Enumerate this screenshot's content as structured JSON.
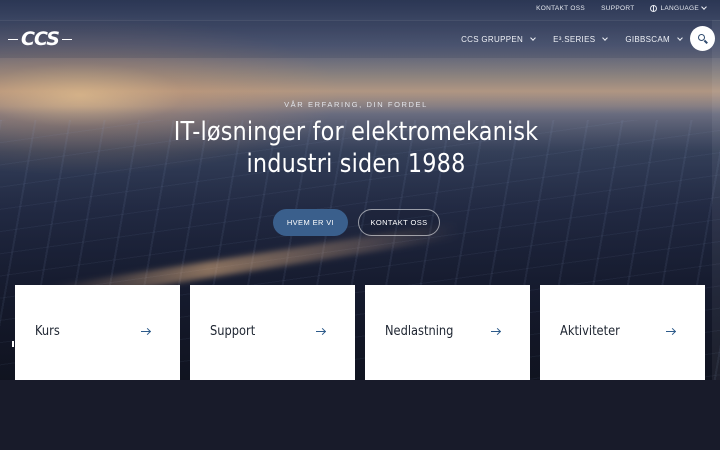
{
  "topbar": {
    "links": [
      "KONTAKT OSS",
      "SUPPORT"
    ],
    "language_label": "LANGUAGE"
  },
  "logo": {
    "text": "CCS"
  },
  "nav": {
    "items": [
      {
        "label": "CCS GRUPPEN"
      },
      {
        "label": "E³.SERIES"
      },
      {
        "label": "GIBBSCAM"
      }
    ],
    "search_icon": "search-icon"
  },
  "hero": {
    "eyebrow": "VÅR ERFARING, DIN FORDEL",
    "headline_line1": "IT-løsninger for elektromekanisk",
    "headline_line2": "industri siden 1988",
    "primary_button": "HVEM ER VI",
    "secondary_button": "KONTAKT OSS"
  },
  "cards": [
    {
      "label": "Kurs"
    },
    {
      "label": "Support"
    },
    {
      "label": "Nedlastning"
    },
    {
      "label": "Aktiviteter"
    }
  ],
  "colors": {
    "accent": "#3a5f8c",
    "arrow": "#2d5a8a",
    "footer_bg": "#181b2a"
  }
}
